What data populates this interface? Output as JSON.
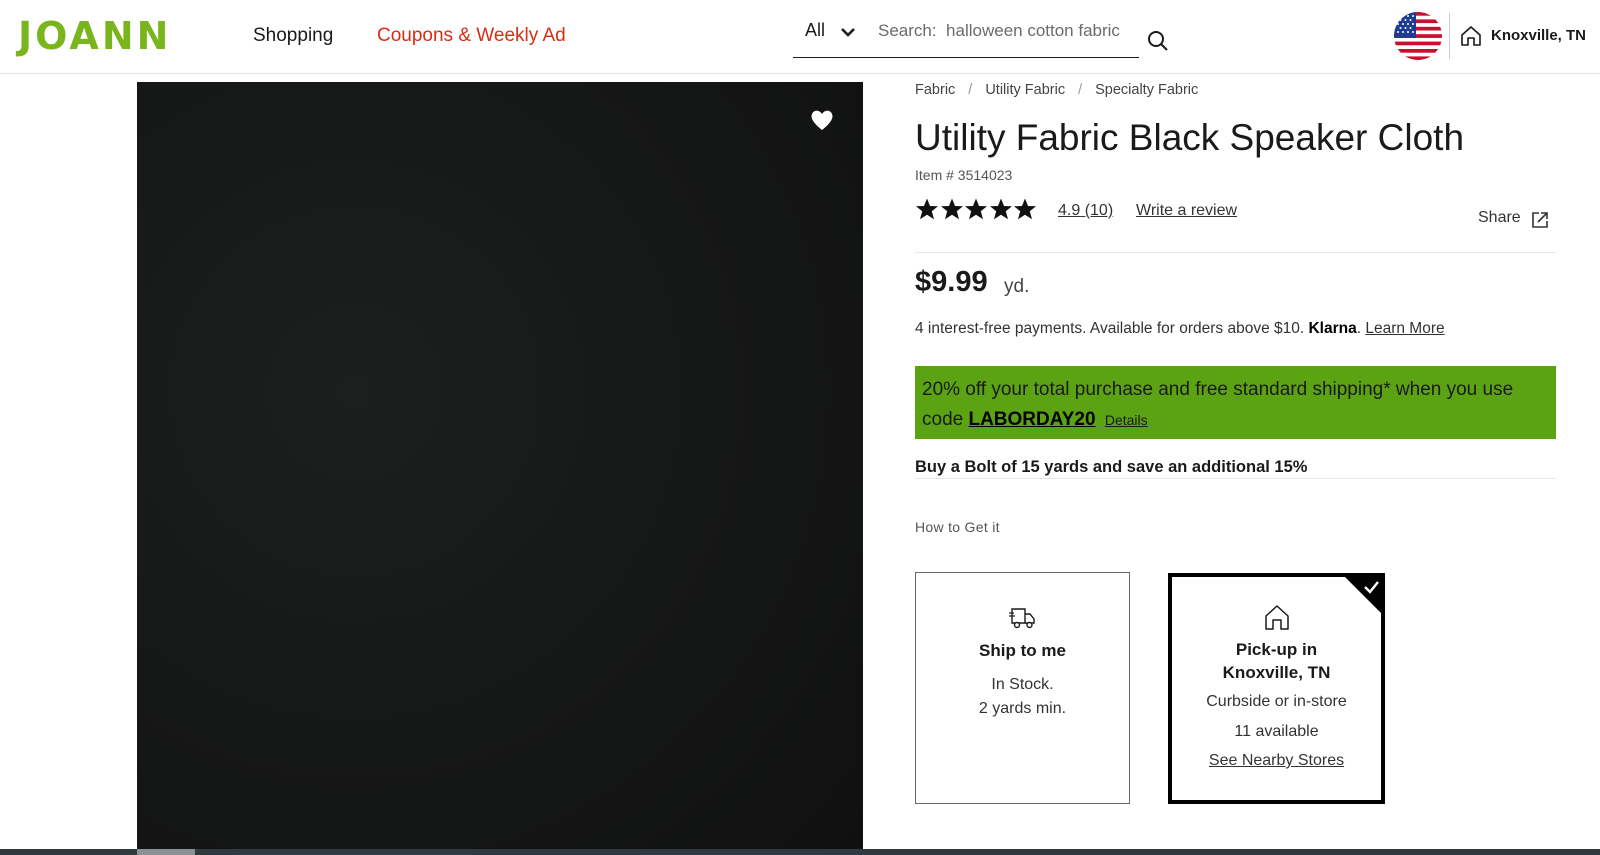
{
  "header": {
    "logo": "JOANN",
    "nav": {
      "shopping": "Shopping",
      "coupons": "Coupons & Weekly Ad"
    },
    "search": {
      "category": "All",
      "label": "Search:",
      "placeholder": "halloween cotton fabric"
    },
    "store": "Knoxville, TN",
    "colors": {
      "logo": "#7ab51d",
      "coupons": "#d82c14"
    }
  },
  "product": {
    "breadcrumb": [
      "Fabric",
      "Utility Fabric",
      "Specialty Fabric"
    ],
    "title": "Utility Fabric Black Speaker Cloth",
    "item_number": "Item # 3514023",
    "rating": {
      "stars": 5,
      "score": "4.9",
      "count": "(10)"
    },
    "write_review": "Write a review",
    "share": "Share",
    "price": "$9.99",
    "price_unit": "yd.",
    "klarna": {
      "text": "4 interest-free payments. Available for orders above $10.",
      "brand": "Klarna",
      "link": "Learn More"
    },
    "promo": {
      "text": "20% off your total purchase and free standard shipping* when you use code",
      "code": "LABORDAY20",
      "details": "Details",
      "color": "#5ba313"
    },
    "bolt_offer": "Buy a Bolt of 15 yards and save an additional 15%",
    "how_to_get": "How to Get it",
    "options": {
      "ship": {
        "title": "Ship to me",
        "line1": "In Stock.",
        "line2": "2 yards min."
      },
      "pickup": {
        "title_line1": "Pick-up in",
        "title_line2": "Knoxville, TN",
        "line1": "Curbside or in-store",
        "line2": "11 available",
        "link": "See Nearby Stores",
        "selected": true
      }
    }
  },
  "icons": [
    "chevron-down-icon",
    "search-icon",
    "us-flag-icon",
    "store-icon",
    "heart-icon",
    "star-icon",
    "share-icon",
    "truck-icon",
    "checkmark-icon"
  ]
}
